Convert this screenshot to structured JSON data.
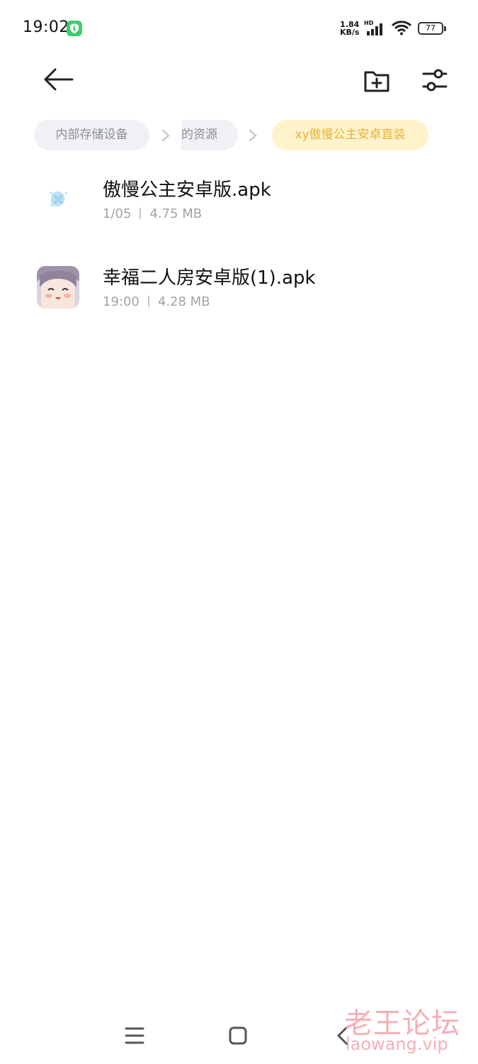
{
  "status_bar": {
    "time": "19:02",
    "net_speed_value": "1.84",
    "net_speed_unit": "KB/s",
    "hd_label": "HD",
    "battery": "77",
    "shield_color": "#3ccf6d"
  },
  "toolbar": {
    "back_icon": "arrow-left-icon",
    "new_folder_icon": "folder-add-icon",
    "filter_icon": "sliders-icon"
  },
  "breadcrumb": {
    "items": [
      {
        "label": "内部存储设备"
      },
      {
        "label": "的资源"
      },
      {
        "label": "xy傲慢公主安卓直装",
        "active": true
      }
    ],
    "active_bg": "#fff3cc",
    "active_color": "#e8b33a"
  },
  "files": [
    {
      "name": "傲慢公主安卓版.apk",
      "date": "1/05",
      "size": "4.75 MB"
    },
    {
      "name": "幸福二人房安卓版(1).apk",
      "date": "19:00",
      "size": "4.28 MB"
    }
  ],
  "nav_bar": {
    "menu_icon": "menu-icon",
    "home_icon": "home-icon",
    "back_icon": "back-icon"
  },
  "watermark": {
    "cn": "老王论坛",
    "en": "laowang.vip"
  }
}
